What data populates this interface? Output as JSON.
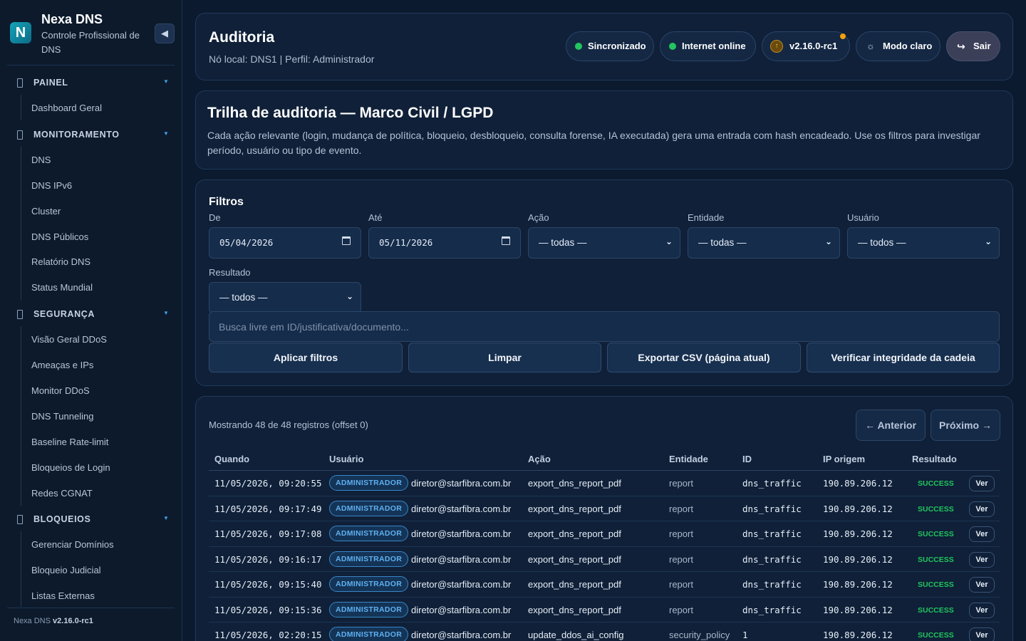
{
  "brand": {
    "logo_letter": "N",
    "title": "Nexa DNS",
    "subtitle": "Controle Profissional de DNS",
    "collapse_icon": "◀"
  },
  "sidebar": {
    "groups": [
      {
        "label": "PAINEL",
        "items": [
          "Dashboard Geral"
        ]
      },
      {
        "label": "MONITORAMENTO",
        "items": [
          "DNS",
          "DNS IPv6",
          "Cluster",
          "DNS Públicos",
          "Relatório DNS",
          "Status Mundial"
        ]
      },
      {
        "label": "SEGURANÇA",
        "items": [
          "Visão Geral DDoS",
          "Ameaças e IPs",
          "Monitor DDoS",
          "DNS Tunneling",
          "Baseline Rate-limit",
          "Bloqueios de Login",
          "Redes CGNAT"
        ]
      },
      {
        "label": "BLOQUEIOS",
        "items": [
          "Gerenciar Domínios",
          "Bloqueio Judicial",
          "Listas Externas"
        ]
      }
    ],
    "footer_prefix": "Nexa DNS",
    "footer_version": "v2.16.0-rc1"
  },
  "header": {
    "title": "Auditoria",
    "subtitle": "Nó local: DNS1 | Perfil: Administrador",
    "pills": {
      "sync": "Sincronizado",
      "internet": "Internet online",
      "version": "v2.16.0-rc1",
      "theme": "Modo claro",
      "logout": "Sair"
    }
  },
  "intro": {
    "title": "Trilha de auditoria — Marco Civil / LGPD",
    "description": "Cada ação relevante (login, mudança de política, bloqueio, desbloqueio, consulta forense, IA executada) gera uma entrada com hash encadeado. Use os filtros para investigar período, usuário ou tipo de evento."
  },
  "filters": {
    "title": "Filtros",
    "from_label": "De",
    "from_value": "05/04/2026",
    "to_label": "Até",
    "to_value": "05/11/2026",
    "action_label": "Ação",
    "action_value": "— todas —",
    "entity_label": "Entidade",
    "entity_value": "— todas —",
    "user_label": "Usuário",
    "user_value": "— todos —",
    "result_label": "Resultado",
    "result_value": "— todos —",
    "search_placeholder": "Busca livre em ID/justificativa/documento...",
    "buttons": {
      "apply": "Aplicar filtros",
      "clear": "Limpar",
      "export": "Exportar CSV (página atual)",
      "verify": "Verificar integridade da cadeia"
    }
  },
  "results": {
    "count_text": "Mostrando 48 de 48 registros (offset 0)",
    "prev": "← Anterior",
    "next": "Próximo →",
    "columns": [
      "Quando",
      "Usuário",
      "Ação",
      "Entidade",
      "ID",
      "IP origem",
      "Resultado"
    ],
    "rows": [
      {
        "when": "11/05/2026, 09:20:55",
        "role": "ADMINISTRADOR",
        "user": "diretor@starfibra.com.br",
        "action": "export_dns_report_pdf",
        "entity": "report",
        "id": "dns_traffic",
        "ip": "190.89.206.12",
        "result": "SUCCESS",
        "view": "Ver"
      },
      {
        "when": "11/05/2026, 09:17:49",
        "role": "ADMINISTRADOR",
        "user": "diretor@starfibra.com.br",
        "action": "export_dns_report_pdf",
        "entity": "report",
        "id": "dns_traffic",
        "ip": "190.89.206.12",
        "result": "SUCCESS",
        "view": "Ver"
      },
      {
        "when": "11/05/2026, 09:17:08",
        "role": "ADMINISTRADOR",
        "user": "diretor@starfibra.com.br",
        "action": "export_dns_report_pdf",
        "entity": "report",
        "id": "dns_traffic",
        "ip": "190.89.206.12",
        "result": "SUCCESS",
        "view": "Ver"
      },
      {
        "when": "11/05/2026, 09:16:17",
        "role": "ADMINISTRADOR",
        "user": "diretor@starfibra.com.br",
        "action": "export_dns_report_pdf",
        "entity": "report",
        "id": "dns_traffic",
        "ip": "190.89.206.12",
        "result": "SUCCESS",
        "view": "Ver"
      },
      {
        "when": "11/05/2026, 09:15:40",
        "role": "ADMINISTRADOR",
        "user": "diretor@starfibra.com.br",
        "action": "export_dns_report_pdf",
        "entity": "report",
        "id": "dns_traffic",
        "ip": "190.89.206.12",
        "result": "SUCCESS",
        "view": "Ver"
      },
      {
        "when": "11/05/2026, 09:15:36",
        "role": "ADMINISTRADOR",
        "user": "diretor@starfibra.com.br",
        "action": "export_dns_report_pdf",
        "entity": "report",
        "id": "dns_traffic",
        "ip": "190.89.206.12",
        "result": "SUCCESS",
        "view": "Ver"
      },
      {
        "when": "11/05/2026, 02:20:15",
        "role": "ADMINISTRADOR",
        "user": "diretor@starfibra.com.br",
        "action": "update_ddos_ai_config",
        "entity": "security_policy",
        "id": "1",
        "ip": "190.89.206.12",
        "result": "SUCCESS",
        "view": "Ver"
      }
    ]
  },
  "colors": {
    "background": "#0b1a2e",
    "panel": "#0f2038",
    "accent_blue": "#3fa3e6",
    "success": "#22c55e",
    "warning": "#f59e0b"
  },
  "icons": {
    "logo": "nexa-logo",
    "collapse": "chevron-left-icon",
    "group": "folder-icon",
    "sync": "status-dot-icon",
    "version": "update-arrow-icon",
    "theme": "sun-icon",
    "logout": "logout-arrow-icon",
    "calendar": "calendar-icon",
    "select": "chevron-down-icon"
  }
}
